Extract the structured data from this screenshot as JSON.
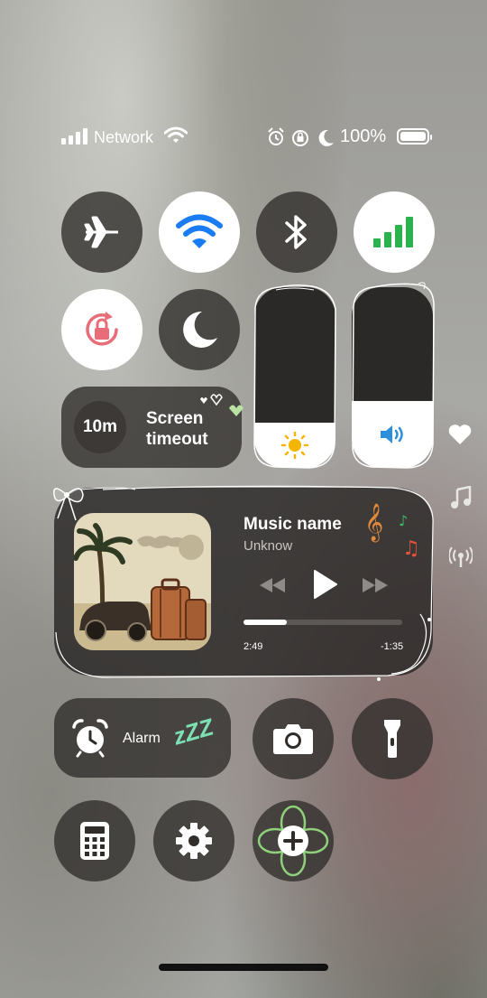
{
  "status_bar": {
    "network": "Network",
    "battery": "100%"
  },
  "screen_timeout": {
    "value": "10m",
    "label_line1": "Screen",
    "label_line2": "timeout"
  },
  "sliders": {
    "brightness_level": 0.25,
    "volume_level": 0.37
  },
  "music": {
    "title": "Music name",
    "artist": "Unknow",
    "elapsed": "2:49",
    "remaining": "-1:35",
    "progress": 0.27
  },
  "alarm": {
    "label": "Alarm",
    "sleep_text": "zZZ"
  },
  "colors": {
    "wifi_active": "#1a7cf2",
    "cellular_active": "#2bb24c",
    "rotation_lock": "#e86d78",
    "brightness_icon": "#f5b400",
    "volume_icon": "#2d8fdc",
    "zzz": "#7de0b3",
    "flower_outline": "#8fd07a",
    "heart_badge": "#b8e3a0"
  },
  "icons": {
    "airplane": "airplane-icon",
    "wifi": "wifi-icon",
    "bluetooth": "bluetooth-icon",
    "cellular": "cellular-icon",
    "rotation_lock": "rotation-lock-icon",
    "moon": "moon-icon",
    "camera": "camera-icon",
    "flashlight": "flashlight-icon",
    "calculator": "calculator-icon",
    "settings": "gear-icon",
    "add": "add-icon"
  }
}
